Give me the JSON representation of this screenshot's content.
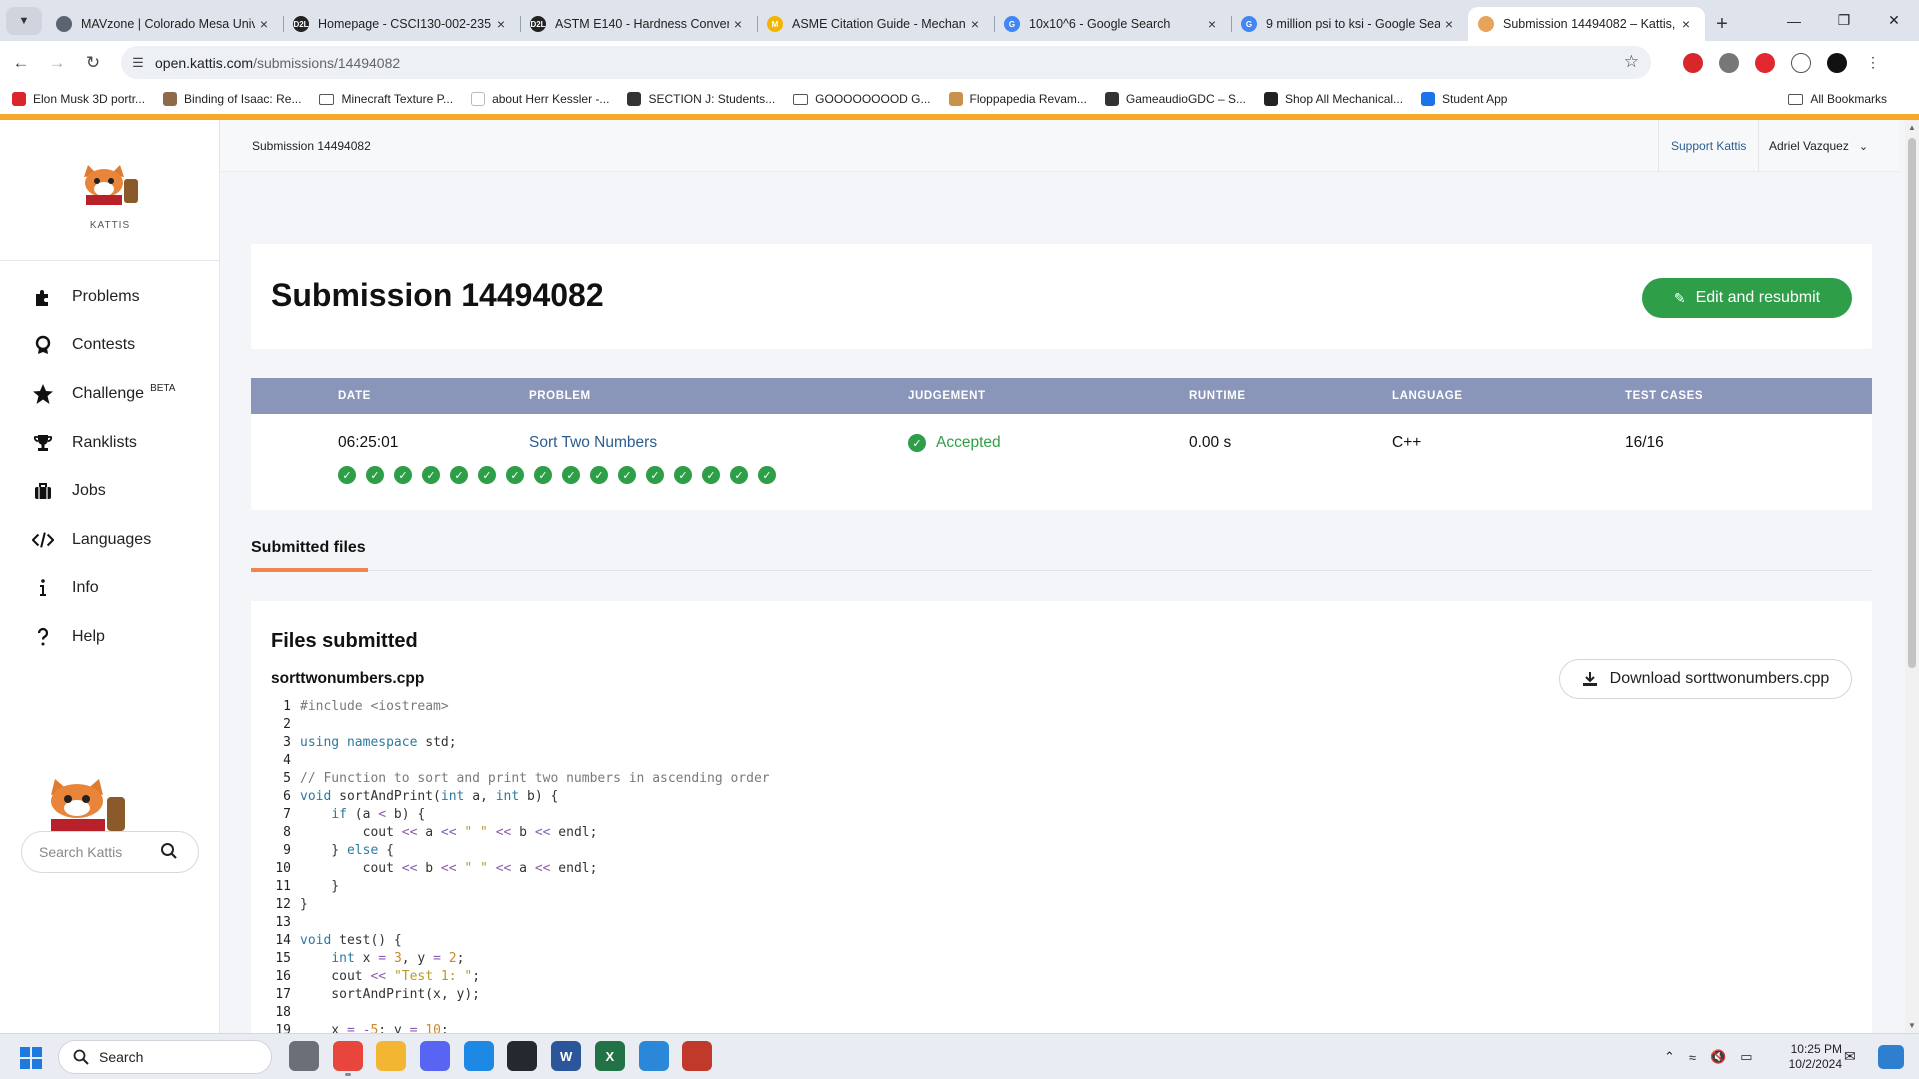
{
  "browser": {
    "tabs": [
      {
        "title": "MAVzone | Colorado Mesa Univ",
        "fav_color": "#5a6472",
        "fav_text": "",
        "active": false
      },
      {
        "title": "Homepage - CSCI130-002-235",
        "fav_color": "#222222",
        "fav_text": "D2L",
        "active": false
      },
      {
        "title": "ASTM E140 - Hardness Convers",
        "fav_color": "#222222",
        "fav_text": "D2L",
        "active": false
      },
      {
        "title": "ASME Citation Guide - Mechan",
        "fav_color": "#f2b400",
        "fav_text": "M",
        "active": false
      },
      {
        "title": "10x10^6 - Google Search",
        "fav_color": "#4285f4",
        "fav_text": "G",
        "active": false
      },
      {
        "title": "9 million psi to ksi - Google Sea",
        "fav_color": "#4285f4",
        "fav_text": "G",
        "active": false
      },
      {
        "title": "Submission 14494082 – Kattis,",
        "fav_color": "#e8a45a",
        "fav_text": "",
        "active": true
      }
    ],
    "url_host": "open.kattis.com",
    "url_path": "/submissions/14494082",
    "bookmarks": [
      {
        "label": "Elon Musk 3D portr...",
        "type": "site",
        "color": "#d8262b"
      },
      {
        "label": "Binding of Isaac: Re...",
        "type": "site",
        "color": "#8e6a4a"
      },
      {
        "label": "Minecraft Texture P...",
        "type": "folder",
        "color": ""
      },
      {
        "label": "about Herr Kessler -...",
        "type": "site",
        "color": "#ffffff"
      },
      {
        "label": "SECTION J: Students...",
        "type": "site",
        "color": "#333333"
      },
      {
        "label": "GOOOOOOOOD G...",
        "type": "folder",
        "color": ""
      },
      {
        "label": "Floppapedia Revam...",
        "type": "site",
        "color": "#c8924a"
      },
      {
        "label": "GameaudioGDC – S...",
        "type": "site",
        "color": "#333333"
      },
      {
        "label": "Shop All Mechanical...",
        "type": "site",
        "color": "#222222"
      },
      {
        "label": "Student App",
        "type": "site",
        "color": "#1a73e8"
      }
    ],
    "all_bookmarks": "All Bookmarks"
  },
  "sidebar": {
    "brand": "KATTIS",
    "nav": [
      {
        "label": "Problems",
        "icon": "puzzle-icon",
        "badge": ""
      },
      {
        "label": "Contests",
        "icon": "medal-icon",
        "badge": ""
      },
      {
        "label": "Challenge",
        "icon": "star-icon",
        "badge": "BETA"
      },
      {
        "label": "Ranklists",
        "icon": "trophy-icon",
        "badge": ""
      },
      {
        "label": "Jobs",
        "icon": "briefcase-icon",
        "badge": ""
      },
      {
        "label": "Languages",
        "icon": "code-icon",
        "badge": ""
      },
      {
        "label": "Info",
        "icon": "info-icon",
        "badge": ""
      },
      {
        "label": "Help",
        "icon": "question-icon",
        "badge": ""
      }
    ],
    "search_placeholder": "Search Kattis"
  },
  "topbar": {
    "breadcrumb": "Submission 14494082",
    "support": "Support Kattis",
    "user": "Adriel Vazquez"
  },
  "submission": {
    "title": "Submission 14494082",
    "edit_button": "Edit and resubmit",
    "columns": [
      "DATE",
      "PROBLEM",
      "JUDGEMENT",
      "RUNTIME",
      "LANGUAGE",
      "TEST CASES"
    ],
    "date": "06:25:01",
    "problem": "Sort Two Numbers",
    "judgement": "Accepted",
    "runtime": "0.00 s",
    "language": "C++",
    "test_cases": "16/16",
    "tests_passed": 16
  },
  "files": {
    "tab_label": "Submitted files",
    "heading": "Files submitted",
    "filename": "sorttwonumbers.cpp",
    "download_label": "Download sorttwonumbers.cpp",
    "code_lines": [
      "#include <iostream>",
      "",
      "using namespace std;",
      "",
      "// Function to sort and print two numbers in ascending order",
      "void sortAndPrint(int a, int b) {",
      "    if (a < b) {",
      "        cout << a << \" \" << b << endl;",
      "    } else {",
      "        cout << b << \" \" << a << endl;",
      "    }",
      "}",
      "",
      "void test() {",
      "    int x = 3, y = 2;",
      "    cout << \"Test 1: \";",
      "    sortAndPrint(x, y);",
      "",
      "    x = -5; y = 10;"
    ]
  },
  "taskbar": {
    "search_label": "Search",
    "time": "10:25 PM",
    "date": "10/2/2024"
  },
  "colors": {
    "accent_bar": "#f6a926",
    "success": "#2e9e48",
    "table_header": "#8a95ba",
    "link": "#2b5c8f",
    "tab_underline": "#f2844f"
  }
}
